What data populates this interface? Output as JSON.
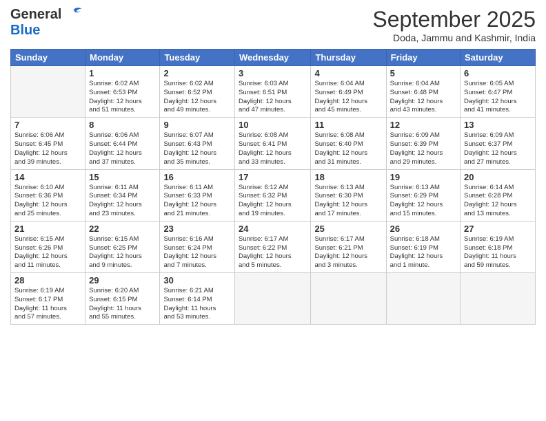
{
  "header": {
    "logo_general": "General",
    "logo_blue": "Blue",
    "month": "September 2025",
    "location": "Doda, Jammu and Kashmir, India"
  },
  "weekdays": [
    "Sunday",
    "Monday",
    "Tuesday",
    "Wednesday",
    "Thursday",
    "Friday",
    "Saturday"
  ],
  "weeks": [
    [
      {
        "day": "",
        "info": ""
      },
      {
        "day": "1",
        "info": "Sunrise: 6:02 AM\nSunset: 6:53 PM\nDaylight: 12 hours\nand 51 minutes."
      },
      {
        "day": "2",
        "info": "Sunrise: 6:02 AM\nSunset: 6:52 PM\nDaylight: 12 hours\nand 49 minutes."
      },
      {
        "day": "3",
        "info": "Sunrise: 6:03 AM\nSunset: 6:51 PM\nDaylight: 12 hours\nand 47 minutes."
      },
      {
        "day": "4",
        "info": "Sunrise: 6:04 AM\nSunset: 6:49 PM\nDaylight: 12 hours\nand 45 minutes."
      },
      {
        "day": "5",
        "info": "Sunrise: 6:04 AM\nSunset: 6:48 PM\nDaylight: 12 hours\nand 43 minutes."
      },
      {
        "day": "6",
        "info": "Sunrise: 6:05 AM\nSunset: 6:47 PM\nDaylight: 12 hours\nand 41 minutes."
      }
    ],
    [
      {
        "day": "7",
        "info": "Sunrise: 6:06 AM\nSunset: 6:45 PM\nDaylight: 12 hours\nand 39 minutes."
      },
      {
        "day": "8",
        "info": "Sunrise: 6:06 AM\nSunset: 6:44 PM\nDaylight: 12 hours\nand 37 minutes."
      },
      {
        "day": "9",
        "info": "Sunrise: 6:07 AM\nSunset: 6:43 PM\nDaylight: 12 hours\nand 35 minutes."
      },
      {
        "day": "10",
        "info": "Sunrise: 6:08 AM\nSunset: 6:41 PM\nDaylight: 12 hours\nand 33 minutes."
      },
      {
        "day": "11",
        "info": "Sunrise: 6:08 AM\nSunset: 6:40 PM\nDaylight: 12 hours\nand 31 minutes."
      },
      {
        "day": "12",
        "info": "Sunrise: 6:09 AM\nSunset: 6:39 PM\nDaylight: 12 hours\nand 29 minutes."
      },
      {
        "day": "13",
        "info": "Sunrise: 6:09 AM\nSunset: 6:37 PM\nDaylight: 12 hours\nand 27 minutes."
      }
    ],
    [
      {
        "day": "14",
        "info": "Sunrise: 6:10 AM\nSunset: 6:36 PM\nDaylight: 12 hours\nand 25 minutes."
      },
      {
        "day": "15",
        "info": "Sunrise: 6:11 AM\nSunset: 6:34 PM\nDaylight: 12 hours\nand 23 minutes."
      },
      {
        "day": "16",
        "info": "Sunrise: 6:11 AM\nSunset: 6:33 PM\nDaylight: 12 hours\nand 21 minutes."
      },
      {
        "day": "17",
        "info": "Sunrise: 6:12 AM\nSunset: 6:32 PM\nDaylight: 12 hours\nand 19 minutes."
      },
      {
        "day": "18",
        "info": "Sunrise: 6:13 AM\nSunset: 6:30 PM\nDaylight: 12 hours\nand 17 minutes."
      },
      {
        "day": "19",
        "info": "Sunrise: 6:13 AM\nSunset: 6:29 PM\nDaylight: 12 hours\nand 15 minutes."
      },
      {
        "day": "20",
        "info": "Sunrise: 6:14 AM\nSunset: 6:28 PM\nDaylight: 12 hours\nand 13 minutes."
      }
    ],
    [
      {
        "day": "21",
        "info": "Sunrise: 6:15 AM\nSunset: 6:26 PM\nDaylight: 12 hours\nand 11 minutes."
      },
      {
        "day": "22",
        "info": "Sunrise: 6:15 AM\nSunset: 6:25 PM\nDaylight: 12 hours\nand 9 minutes."
      },
      {
        "day": "23",
        "info": "Sunrise: 6:16 AM\nSunset: 6:24 PM\nDaylight: 12 hours\nand 7 minutes."
      },
      {
        "day": "24",
        "info": "Sunrise: 6:17 AM\nSunset: 6:22 PM\nDaylight: 12 hours\nand 5 minutes."
      },
      {
        "day": "25",
        "info": "Sunrise: 6:17 AM\nSunset: 6:21 PM\nDaylight: 12 hours\nand 3 minutes."
      },
      {
        "day": "26",
        "info": "Sunrise: 6:18 AM\nSunset: 6:19 PM\nDaylight: 12 hours\nand 1 minute."
      },
      {
        "day": "27",
        "info": "Sunrise: 6:19 AM\nSunset: 6:18 PM\nDaylight: 11 hours\nand 59 minutes."
      }
    ],
    [
      {
        "day": "28",
        "info": "Sunrise: 6:19 AM\nSunset: 6:17 PM\nDaylight: 11 hours\nand 57 minutes."
      },
      {
        "day": "29",
        "info": "Sunrise: 6:20 AM\nSunset: 6:15 PM\nDaylight: 11 hours\nand 55 minutes."
      },
      {
        "day": "30",
        "info": "Sunrise: 6:21 AM\nSunset: 6:14 PM\nDaylight: 11 hours\nand 53 minutes."
      },
      {
        "day": "",
        "info": ""
      },
      {
        "day": "",
        "info": ""
      },
      {
        "day": "",
        "info": ""
      },
      {
        "day": "",
        "info": ""
      }
    ]
  ]
}
